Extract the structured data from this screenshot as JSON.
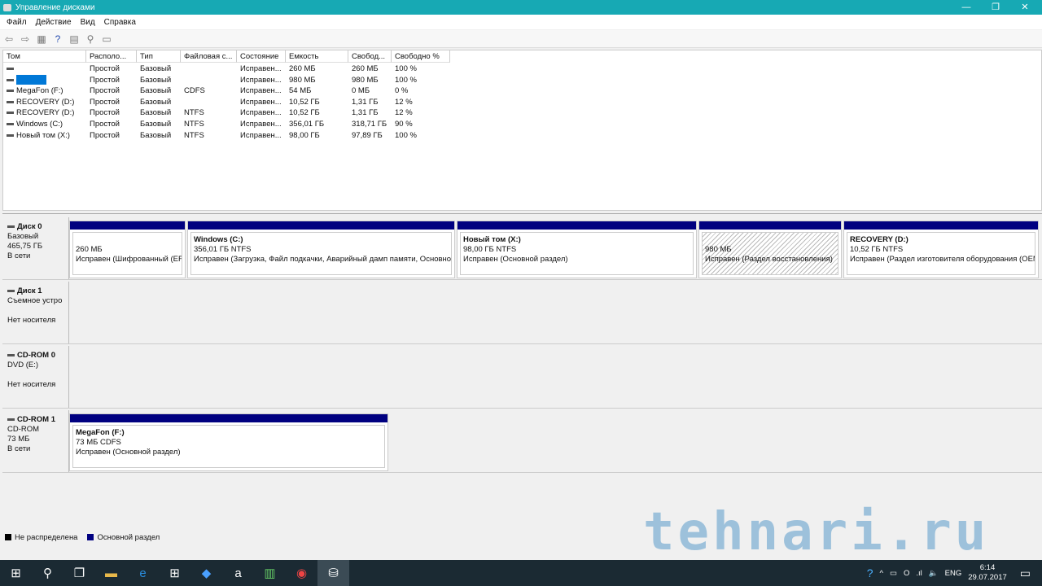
{
  "window": {
    "title": "Управление дисками",
    "min": "—",
    "max": "❐",
    "close": "✕"
  },
  "menu": [
    "Файл",
    "Действие",
    "Вид",
    "Справка"
  ],
  "columns": [
    "Том",
    "Располо...",
    "Тип",
    "Файловая с...",
    "Состояние",
    "Емкость",
    "Свобод...",
    "Свободно %"
  ],
  "volumes": [
    [
      "",
      "Простой",
      "Базовый",
      "",
      "Исправен...",
      "260 МБ",
      "260 МБ",
      "100 %"
    ],
    [
      "",
      "Простой",
      "Базовый",
      "",
      "Исправен...",
      "980 МБ",
      "980 МБ",
      "100 %"
    ],
    [
      "MegaFon (F:)",
      "Простой",
      "Базовый",
      "CDFS",
      "Исправен...",
      "54 МБ",
      "0 МБ",
      "0 %"
    ],
    [
      "RECOVERY (D:)",
      "Простой",
      "Базовый",
      "",
      "Исправен...",
      "10,52 ГБ",
      "1,31 ГБ",
      "12 %"
    ],
    [
      "RECOVERY (D:)",
      "Простой",
      "Базовый",
      "NTFS",
      "Исправен...",
      "10,52 ГБ",
      "1,31 ГБ",
      "12 %"
    ],
    [
      "Windows (C:)",
      "Простой",
      "Базовый",
      "NTFS",
      "Исправен...",
      "356,01 ГБ",
      "318,71 ГБ",
      "90 %"
    ],
    [
      "Новый том (X:)",
      "Простой",
      "Базовый",
      "NTFS",
      "Исправен...",
      "98,00 ГБ",
      "97,89 ГБ",
      "100 %"
    ]
  ],
  "disks": [
    {
      "name": "Диск 0",
      "l1": "Базовый",
      "l2": "465,75 ГБ",
      "l3": "В сети",
      "parts": [
        {
          "name": "",
          "size": "260 МБ",
          "status": "Исправен (Шифрованный (EF"
        },
        {
          "name": "Windows  (C:)",
          "size": "356,01 ГБ NTFS",
          "status": "Исправен (Загрузка, Файл подкачки, Аварийный дамп памяти, Основно"
        },
        {
          "name": "Новый том  (X:)",
          "size": "98,00 ГБ NTFS",
          "status": "Исправен (Основной раздел)"
        },
        {
          "name": "",
          "size": "980 МБ",
          "status": "Исправен (Раздел восстановления)"
        },
        {
          "name": "RECOVERY  (D:)",
          "size": "10,52 ГБ NTFS",
          "status": "Исправен (Раздел изготовителя оборудования (OEM"
        }
      ]
    },
    {
      "name": "Диск 1",
      "l1": "Съемное устро",
      "l2": "",
      "l3": "Нет носителя"
    },
    {
      "name": "CD-ROM 0",
      "l1": "DVD (E:)",
      "l2": "",
      "l3": "Нет носителя"
    },
    {
      "name": "CD-ROM 1",
      "l1": "CD-ROM",
      "l2": "73 МБ",
      "l3": "В сети",
      "parts": [
        {
          "name": "MegaFon  (F:)",
          "size": "73 МБ CDFS",
          "status": "Исправен (Основной раздел)"
        }
      ]
    }
  ],
  "legend": [
    {
      "label": "Не распределена",
      "color": "#000000"
    },
    {
      "label": "Основной раздел",
      "color": "#000080"
    }
  ],
  "watermark": "tehnari.ru",
  "tray": {
    "lang": "ENG",
    "time": "6:14",
    "date": "29.07.2017"
  }
}
